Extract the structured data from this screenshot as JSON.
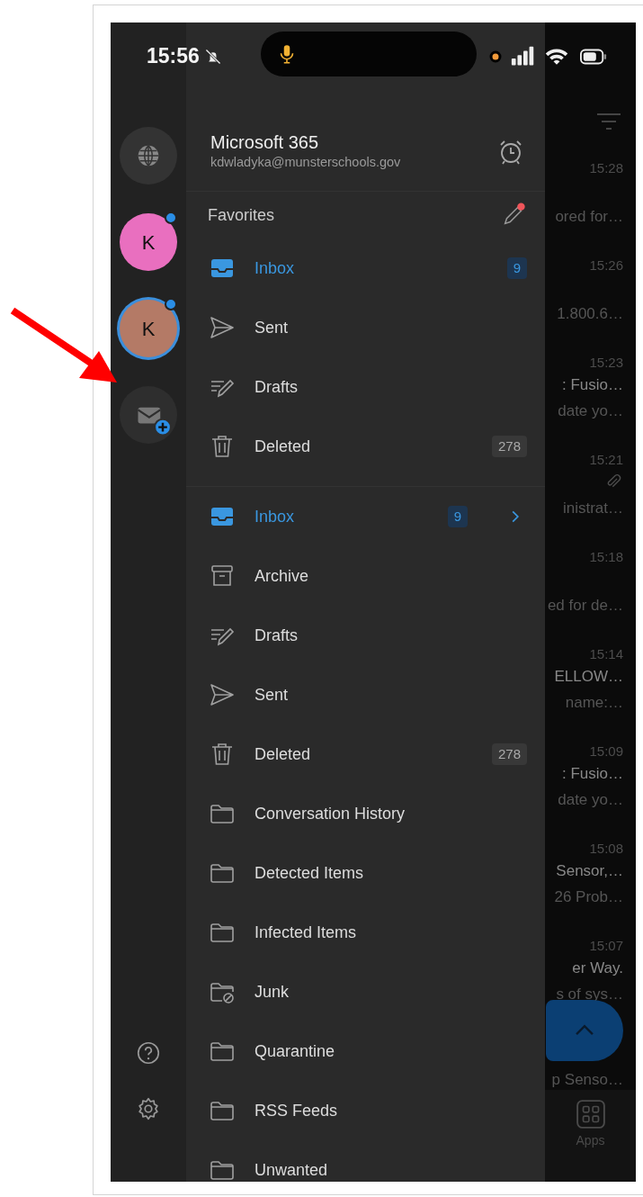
{
  "status_bar": {
    "time": "15:56",
    "silent": true
  },
  "rail": {
    "accounts": [
      {
        "initial": "K",
        "color": "#e96fbf",
        "selected": false,
        "unread": true
      },
      {
        "initial": "K",
        "color": "#b47a66",
        "selected": true,
        "unread": true
      }
    ]
  },
  "drawer": {
    "title": "Microsoft 365",
    "email": "kdwladyka@munsterschools.gov",
    "favorites": {
      "heading": "Favorites",
      "items": [
        {
          "kind": "inbox",
          "label": "Inbox",
          "count": "9",
          "selected": true
        },
        {
          "kind": "sent",
          "label": "Sent",
          "selected": false
        },
        {
          "kind": "drafts",
          "label": "Drafts",
          "selected": false
        },
        {
          "kind": "deleted",
          "label": "Deleted",
          "count": "278",
          "selected": false
        }
      ]
    },
    "folders": [
      {
        "kind": "inbox",
        "label": "Inbox",
        "count": "9",
        "selected": true,
        "expandable": true
      },
      {
        "kind": "archive",
        "label": "Archive",
        "selected": false
      },
      {
        "kind": "drafts",
        "label": "Drafts",
        "selected": false
      },
      {
        "kind": "sent",
        "label": "Sent",
        "selected": false
      },
      {
        "kind": "deleted",
        "label": "Deleted",
        "count": "278",
        "selected": false
      },
      {
        "kind": "folder",
        "label": "Conversation History",
        "selected": false
      },
      {
        "kind": "folder",
        "label": "Detected Items",
        "selected": false
      },
      {
        "kind": "folder",
        "label": "Infected Items",
        "selected": false
      },
      {
        "kind": "junk",
        "label": "Junk",
        "selected": false
      },
      {
        "kind": "folder",
        "label": "Quarantine",
        "selected": false
      },
      {
        "kind": "folder",
        "label": "RSS Feeds",
        "selected": false
      },
      {
        "kind": "folder",
        "label": "Unwanted",
        "selected": false
      }
    ]
  },
  "message_list": {
    "items": [
      {
        "time": "15:28",
        "lines": [
          "ored for…"
        ]
      },
      {
        "time": "15:26",
        "lines": [
          "1.800.6…"
        ]
      },
      {
        "time": "15:23",
        "lines": [
          ": Fusio…",
          "date yo…"
        ]
      },
      {
        "time": "15:21",
        "attachment": true,
        "lines": [
          "inistrat…"
        ]
      },
      {
        "time": "15:18",
        "lines": [
          "ed for de…"
        ]
      },
      {
        "time": "15:14",
        "lines": [
          "ELLOW…",
          "name:…"
        ]
      },
      {
        "time": "15:09",
        "lines": [
          ": Fusio…",
          "date yo…"
        ]
      },
      {
        "time": "15:08",
        "lines": [
          "Sensor,…",
          "26 Prob…"
        ]
      },
      {
        "time": "15:07",
        "lines": [
          "er Way.",
          "s of sys…"
        ]
      },
      {
        "lines": [
          "p Senso…"
        ]
      }
    ],
    "bottom_nav": {
      "label": "Apps"
    }
  }
}
